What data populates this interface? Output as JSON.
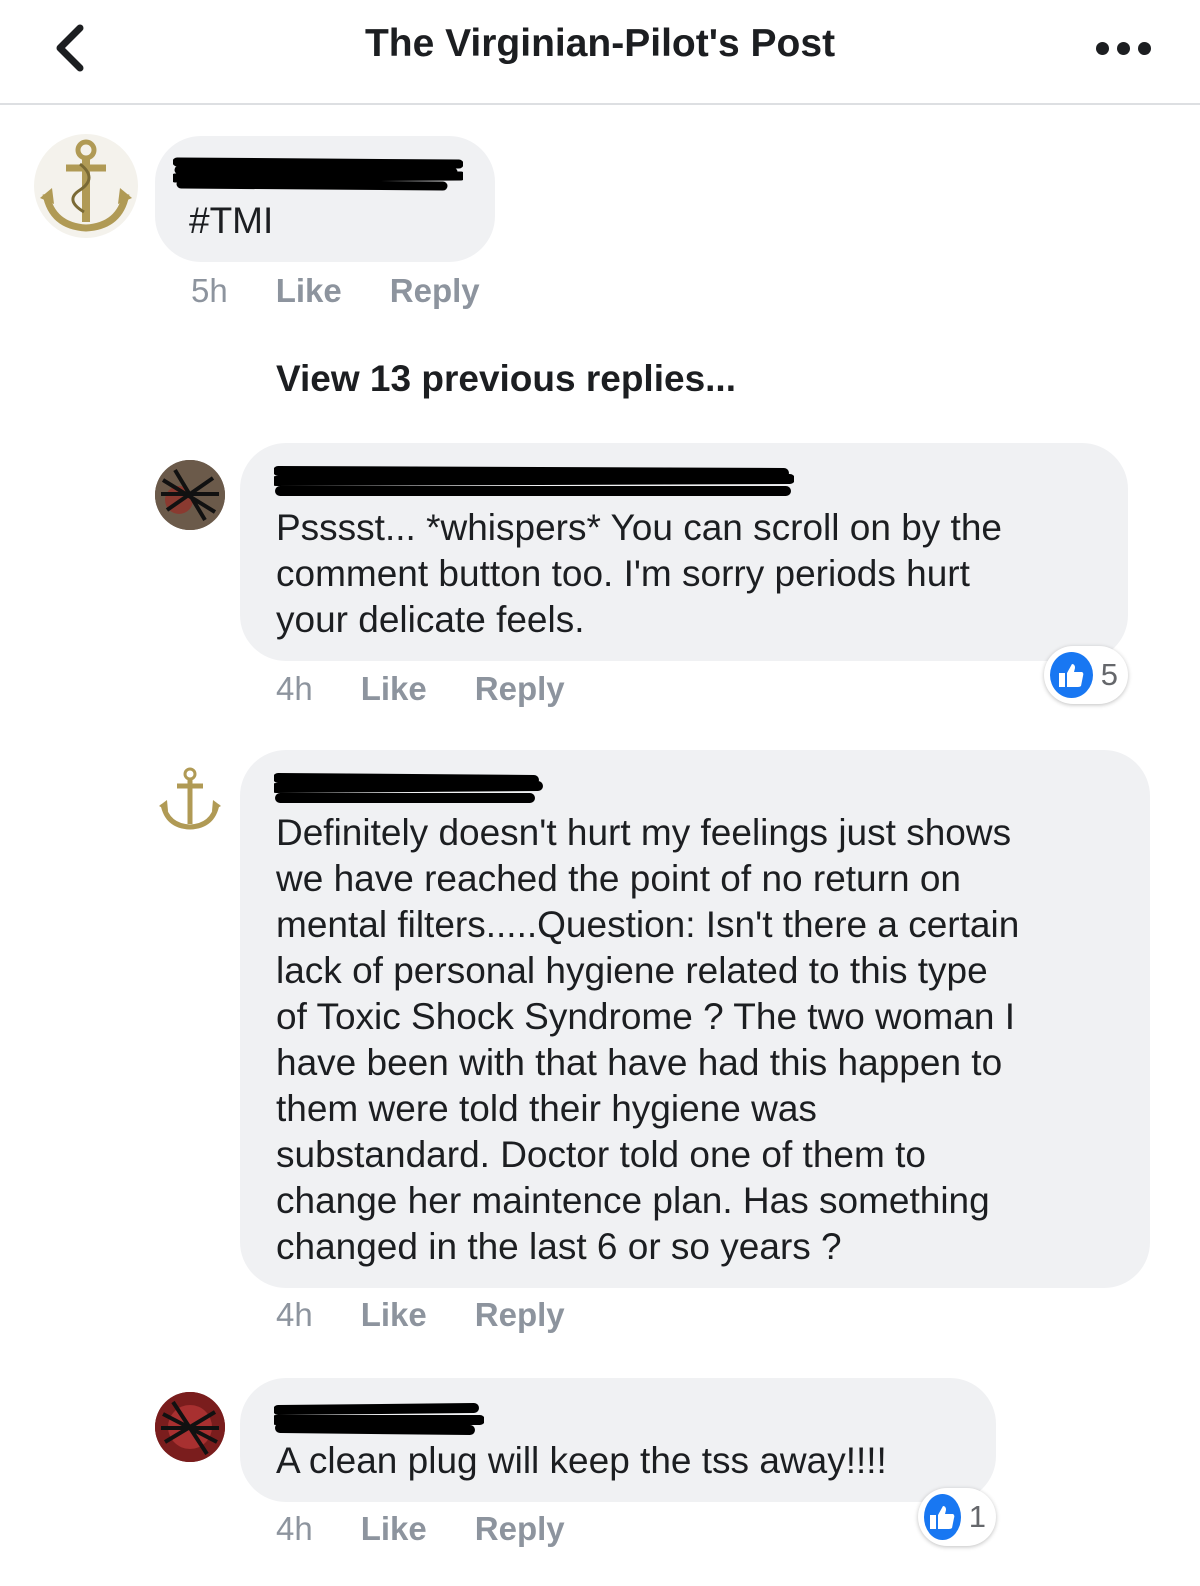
{
  "header": {
    "title": "The Virginian-Pilot's Post",
    "back_icon": "chevron-left-icon",
    "more_icon": "ellipsis-icon"
  },
  "comments": [
    {
      "text": "#TMI",
      "time": "5h",
      "like_label": "Like",
      "reply_label": "Reply",
      "avatar_icon": "anchor-icon"
    },
    {
      "text": "Psssst... *whispers* You can scroll on by the\ncomment button too. I'm sorry periods hurt\nyour delicate feels.",
      "time": "4h",
      "like_label": "Like",
      "reply_label": "Reply",
      "reaction_count": "5",
      "avatar_icon": "profile-photo"
    },
    {
      "text": "Definitely doesn't hurt my feelings just shows\nwe have reached the point of no return on\nmental filters.....Question: Isn't there a certain\nlack of personal hygiene related to this type\nof Toxic Shock Syndrome ? The two woman I\nhave been with that have had this happen to\nthem were told their hygiene  was\nsubstandard. Doctor told one of them to\nchange her maintence plan. Has something\nchanged in the last 6 or so years ?",
      "time": "4h",
      "like_label": "Like",
      "reply_label": "Reply",
      "avatar_icon": "anchor-icon"
    },
    {
      "text": "A clean plug will keep the tss away!!!!",
      "time": "4h",
      "like_label": "Like",
      "reply_label": "Reply",
      "reaction_count": "1",
      "avatar_icon": "profile-photo"
    }
  ],
  "view_previous": "View 13 previous replies...",
  "colors": {
    "bubble": "#f0f1f3",
    "meta": "#8d949e",
    "like_blue": "#1877f2",
    "anchor_gold": "#b09a55"
  }
}
